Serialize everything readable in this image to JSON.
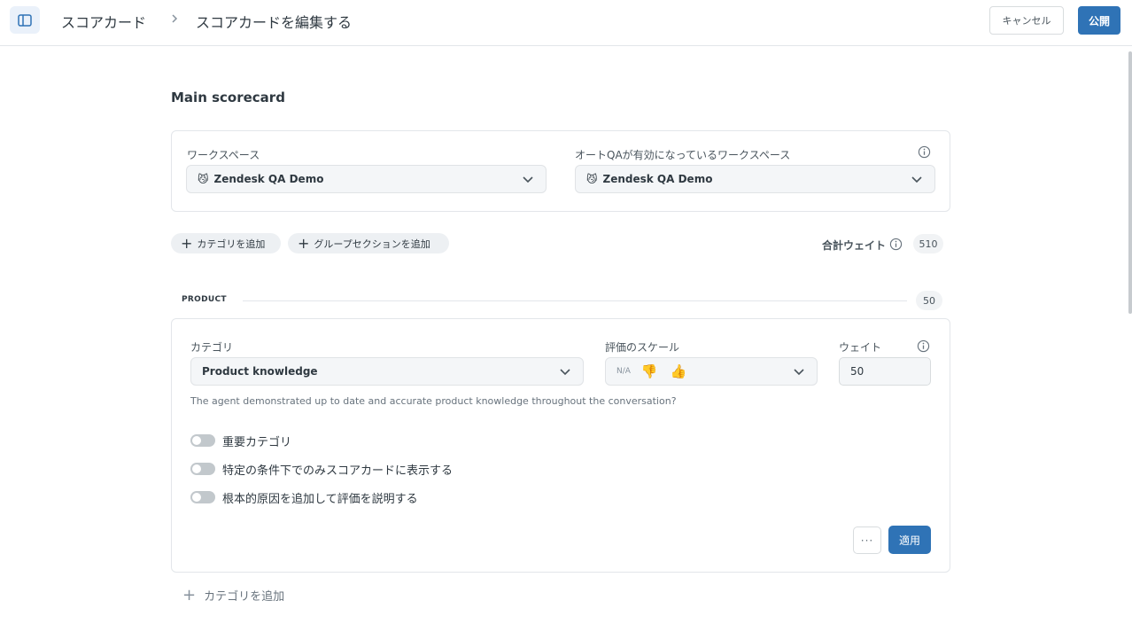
{
  "header": {
    "breadcrumb_root": "スコアカード",
    "breadcrumb_current": "スコアカードを編集する",
    "cancel_label": "キャンセル",
    "publish_label": "公開",
    "accent_color": "#2f73b6"
  },
  "scorecard": {
    "title": "Main scorecard",
    "workspace_label": "ワークスペース",
    "workspace_value": "Zendesk QA Demo",
    "autoqa_label": "オートQAが有効になっているワークスペース",
    "autoqa_value": "Zendesk QA Demo",
    "add_category_label": "カテゴリを追加",
    "add_group_label": "グループセクションを追加",
    "total_weight_label": "合計ウェイト",
    "total_weight_value": "510"
  },
  "section": {
    "name": "PRODUCT",
    "weight": "50"
  },
  "category": {
    "category_label": "カテゴリ",
    "category_value": "Product knowledge",
    "scale_label": "評価のスケール",
    "scale_na": "N/A",
    "scale_icons": [
      "thumbs-down-icon",
      "thumbs-up-icon"
    ],
    "weight_label": "ウェイト",
    "weight_value": "50",
    "description": "The agent demonstrated up to date and accurate product knowledge throughout the conversation?",
    "toggles": [
      {
        "label": "重要カテゴリ",
        "on": false
      },
      {
        "label": "特定の条件下でのみスコアカードに表示する",
        "on": false
      },
      {
        "label": "根本的原因を追加して評価を説明する",
        "on": false
      }
    ],
    "more_label": "···",
    "apply_label": "適用"
  },
  "footer": {
    "add_category_label": "カテゴリを追加"
  }
}
